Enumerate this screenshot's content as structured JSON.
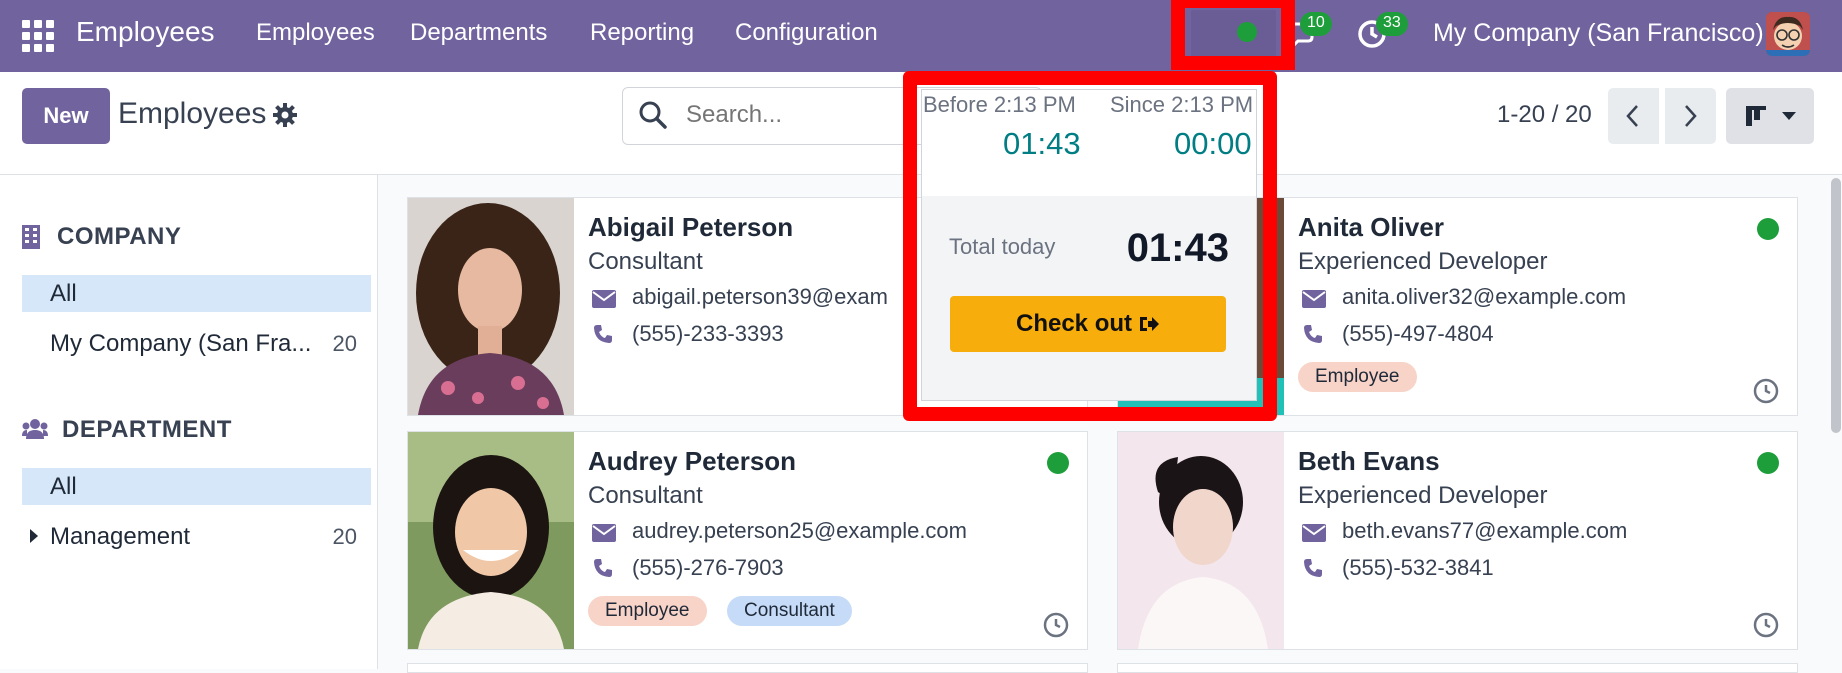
{
  "navbar": {
    "app_name": "Employees",
    "menu": [
      "Employees",
      "Departments",
      "Reporting",
      "Configuration"
    ],
    "messages_count": "10",
    "activities_count": "33",
    "company": "My Company (San Francisco)"
  },
  "control_panel": {
    "new_label": "New",
    "title": "Employees",
    "search_placeholder": "Search...",
    "pager": "1-20 / 20"
  },
  "sidebar": {
    "company": {
      "title": "COMPANY",
      "items": [
        {
          "label": "All",
          "count": ""
        },
        {
          "label": "My Company (San Fra...",
          "count": "20"
        }
      ]
    },
    "department": {
      "title": "DEPARTMENT",
      "items": [
        {
          "label": "All",
          "count": ""
        },
        {
          "label": "Management",
          "count": "20"
        }
      ]
    }
  },
  "employees": [
    {
      "name": "Abigail Peterson",
      "job": "Consultant",
      "email": "abigail.peterson39@exam",
      "phone": "(555)-233-3393",
      "tags": []
    },
    {
      "name": "Anita Oliver",
      "job": "Experienced Developer",
      "email": "anita.oliver32@example.com",
      "phone": "(555)-497-4804",
      "tags": [
        "Employee"
      ]
    },
    {
      "name": "Audrey Peterson",
      "job": "Consultant",
      "email": "audrey.peterson25@example.com",
      "phone": "(555)-276-7903",
      "tags": [
        "Employee",
        "Consultant"
      ]
    },
    {
      "name": "Beth Evans",
      "job": "Experienced Developer",
      "email": "beth.evans77@example.com",
      "phone": "(555)-532-3841",
      "tags": []
    }
  ],
  "attendance_popover": {
    "before_label": "Before 2:13 PM",
    "before_value": "01:43",
    "since_label": "Since 2:13 PM",
    "since_value": "00:00",
    "total_label": "Total today",
    "total_value": "01:43",
    "checkout_label": "Check out"
  },
  "colors": {
    "brand": "#71639e",
    "online": "#1e9e3a",
    "checkout": "#f7ad0c",
    "highlight": "#ff0000",
    "timer": "#017e84"
  }
}
